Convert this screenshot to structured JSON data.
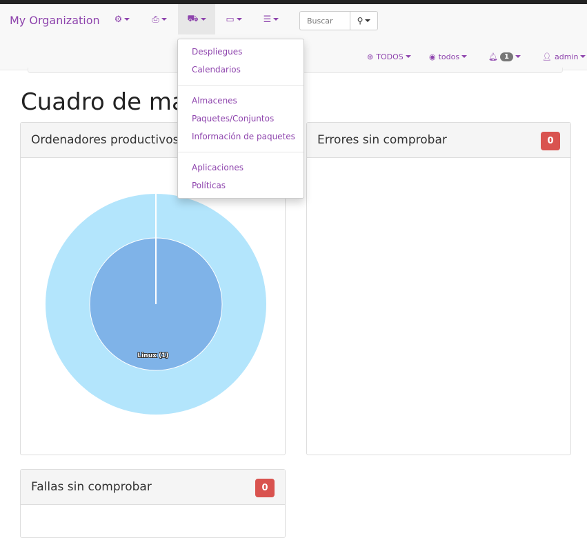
{
  "navbar": {
    "brand": "My Organization",
    "icons": [
      "gears-icon",
      "printer-icon",
      "truck-icon",
      "laptop-icon",
      "list-icon"
    ],
    "search": {
      "placeholder": "Buscar"
    },
    "right": {
      "scope": "TODOS",
      "view": "todos",
      "notifications": "1",
      "user": "admin"
    }
  },
  "dropdown": {
    "groups": [
      [
        "Despliegues",
        "Calendarios"
      ],
      [
        "Almacenes",
        "Paquetes/Conjuntos",
        "Información de paquetes"
      ],
      [
        "Aplicaciones",
        "Políticas"
      ]
    ]
  },
  "page": {
    "title": "Cuadro de mando"
  },
  "panels": {
    "productive": {
      "title": "Ordenadores productivos"
    },
    "errors": {
      "title": "Errores sin comprobar",
      "count": "0"
    },
    "faults": {
      "title": "Fallas sin comprobar",
      "count": "0"
    }
  },
  "chart_data": {
    "type": "pie",
    "inner": [
      {
        "label": "Linux (1)",
        "value": 1,
        "color": "#7fb3e8"
      }
    ],
    "outer": [
      {
        "value": 1,
        "color": "#b3e5fc"
      }
    ]
  }
}
